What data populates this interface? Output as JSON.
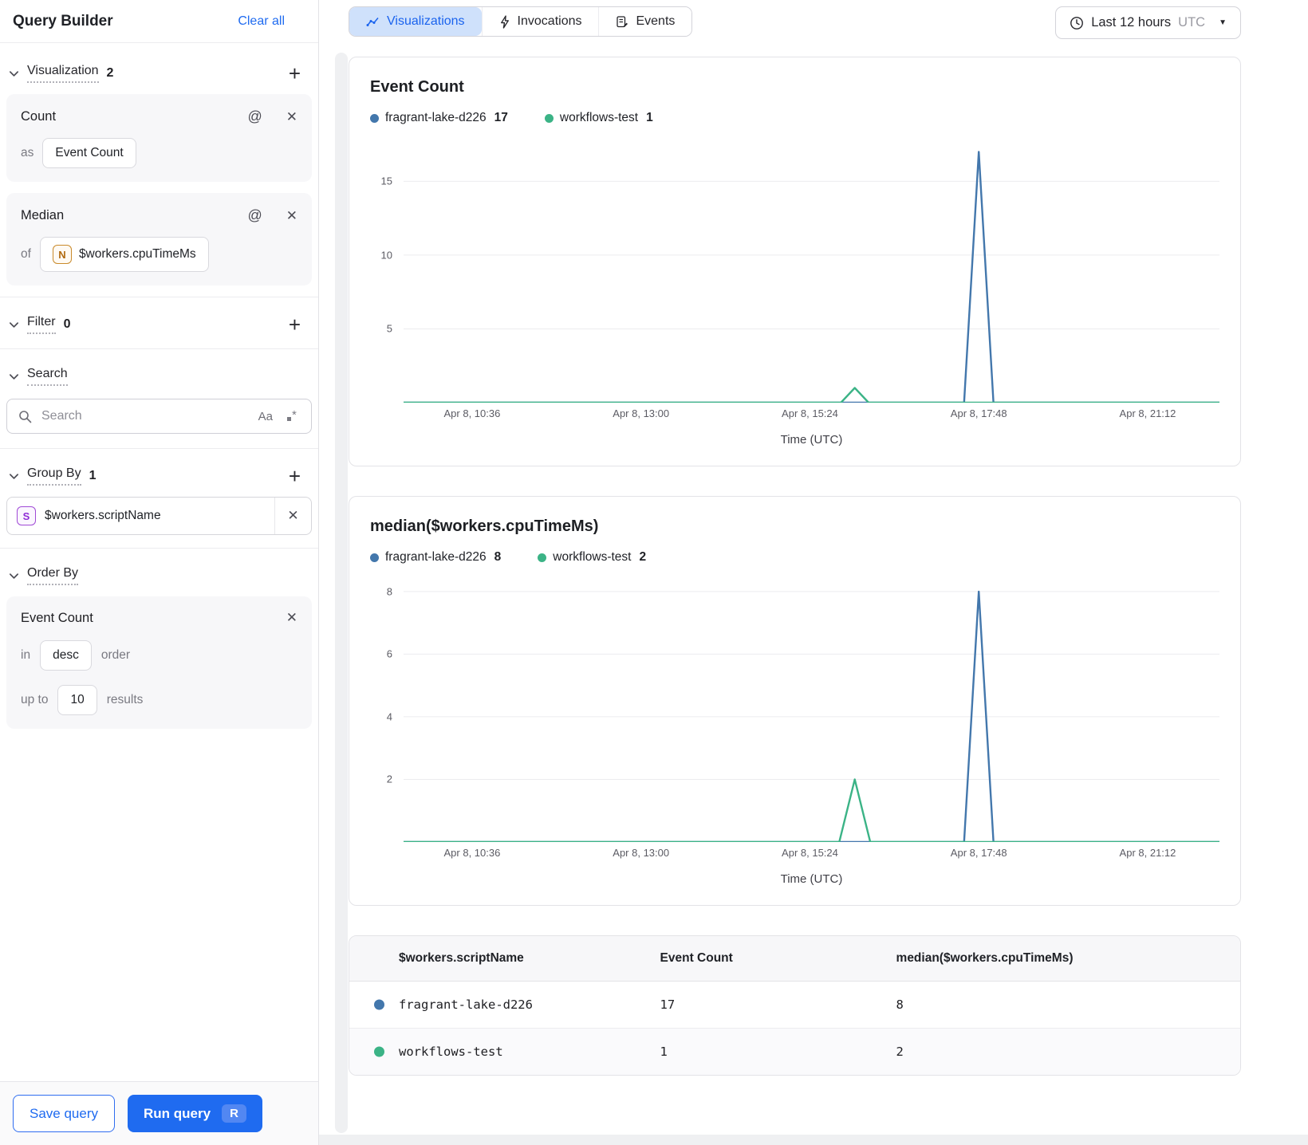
{
  "colors": {
    "primary_blue": "#1f6bf0",
    "active_tab_bg": "#cfe1fb",
    "series_blue": "#4377ac",
    "series_green": "#3bb386"
  },
  "sidebar": {
    "title": "Query Builder",
    "clear_all_label": "Clear all",
    "visualization_section": {
      "label": "Visualization",
      "count": "2"
    },
    "cards": [
      {
        "title": "Count",
        "prefix": "as",
        "value": "Event Count"
      },
      {
        "title": "Median",
        "prefix": "of",
        "value": "$workers.cpuTimeMs",
        "icon_letter": "N"
      }
    ],
    "filter_section": {
      "label": "Filter",
      "count": "0"
    },
    "search_section": {
      "label": "Search",
      "placeholder": "Search",
      "case_toggle": "Aa"
    },
    "group_by_section": {
      "label": "Group By",
      "count": "1",
      "value": "$workers.scriptName",
      "icon_letter": "S"
    },
    "order_by_section": {
      "label": "Order By",
      "field": "Event Count",
      "in_label": "in",
      "direction": "desc",
      "order_label": "order",
      "upto_label": "up to",
      "limit": "10",
      "results_label": "results"
    },
    "save_button_label": "Save query",
    "run_button_label": "Run query",
    "run_shortcut": "R"
  },
  "topbar": {
    "tabs": [
      {
        "label": "Visualizations",
        "active": true
      },
      {
        "label": "Invocations",
        "active": false
      },
      {
        "label": "Events",
        "active": false
      }
    ],
    "time_range": {
      "label": "Last 12 hours",
      "timezone": "UTC"
    }
  },
  "chart_data": [
    {
      "type": "line",
      "title": "Event Count",
      "xlabel": "Time (UTC)",
      "x_ticks": [
        "Apr 8, 10:36",
        "Apr 8, 13:00",
        "Apr 8, 15:24",
        "Apr 8, 17:48",
        "Apr 8, 21:12"
      ],
      "y_ticks": [
        5,
        10,
        15
      ],
      "ylim": [
        0,
        17.4
      ],
      "grid": true,
      "legend_position": "top",
      "series": [
        {
          "name": "fragrant-lake-d226",
          "legend_value": 17,
          "color": "#4377ac",
          "points": [
            [
              0,
              0
            ],
            [
              0.687,
              0
            ],
            [
              0.705,
              17
            ],
            [
              0.723,
              0
            ],
            [
              1,
              0
            ]
          ]
        },
        {
          "name": "workflows-test",
          "legend_value": 1,
          "color": "#3bb386",
          "points": [
            [
              0,
              0
            ],
            [
              0.536,
              0
            ],
            [
              0.553,
              1
            ],
            [
              0.57,
              0
            ],
            [
              1,
              0
            ]
          ]
        }
      ]
    },
    {
      "type": "line",
      "title": "median($workers.cpuTimeMs)",
      "xlabel": "Time (UTC)",
      "x_ticks": [
        "Apr 8, 10:36",
        "Apr 8, 13:00",
        "Apr 8, 15:24",
        "Apr 8, 17:48",
        "Apr 8, 21:12"
      ],
      "y_ticks": [
        2,
        4,
        6,
        8
      ],
      "ylim": [
        0,
        8.2
      ],
      "grid": true,
      "legend_position": "top",
      "series": [
        {
          "name": "fragrant-lake-d226",
          "legend_value": 8,
          "color": "#4377ac",
          "points": [
            [
              0,
              0
            ],
            [
              0.687,
              0
            ],
            [
              0.705,
              8
            ],
            [
              0.723,
              0
            ],
            [
              1,
              0
            ]
          ]
        },
        {
          "name": "workflows-test",
          "legend_value": 2,
          "color": "#3bb386",
          "points": [
            [
              0,
              0
            ],
            [
              0.534,
              0
            ],
            [
              0.553,
              2
            ],
            [
              0.572,
              0
            ],
            [
              1,
              0
            ]
          ]
        }
      ]
    }
  ],
  "table": {
    "columns": [
      "$workers.scriptName",
      "Event Count",
      "median($workers.cpuTimeMs)"
    ],
    "rows": [
      {
        "dot_color": "#4377ac",
        "script_name": "fragrant-lake-d226",
        "event_count": "17",
        "median_cpu": "8"
      },
      {
        "dot_color": "#3bb386",
        "script_name": "workflows-test",
        "event_count": "1",
        "median_cpu": "2"
      }
    ]
  }
}
